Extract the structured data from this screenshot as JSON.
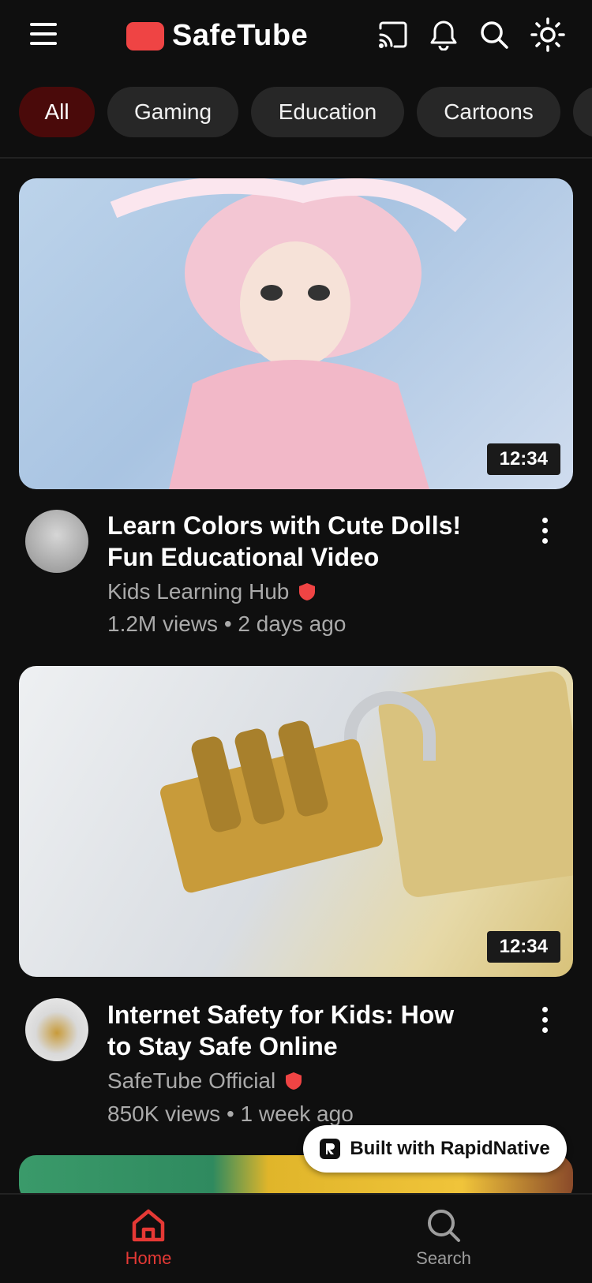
{
  "header": {
    "app_name": "SafeTube",
    "brand_color": "#ef4444",
    "icons": [
      "menu-icon",
      "cast-icon",
      "bell-icon",
      "search-icon",
      "sun-icon"
    ]
  },
  "chips": [
    {
      "label": "All",
      "active": true
    },
    {
      "label": "Gaming",
      "active": false
    },
    {
      "label": "Education",
      "active": false
    },
    {
      "label": "Cartoons",
      "active": false
    }
  ],
  "videos": [
    {
      "title_line1": "Learn Colors with Cute Dolls!",
      "title_line2": "Fun Educational Video",
      "channel": "Kids Learning Hub",
      "meta": "1.2M views • 2 days ago",
      "duration": "12:34",
      "verified_icon": "shield-icon"
    },
    {
      "title_line1": "Internet Safety for Kids: How",
      "title_line2": "to Stay Safe Online",
      "channel": "SafeTube Official",
      "meta": "850K views • 1 week ago",
      "duration": "12:34",
      "verified_icon": "shield-icon"
    }
  ],
  "badge": {
    "label": "Built with RapidNative"
  },
  "bottom_nav": [
    {
      "label": "Home",
      "icon": "home-icon",
      "active": true,
      "color": "#e53935"
    },
    {
      "label": "Search",
      "icon": "search-icon",
      "active": false,
      "color": "#9e9e9e"
    }
  ]
}
